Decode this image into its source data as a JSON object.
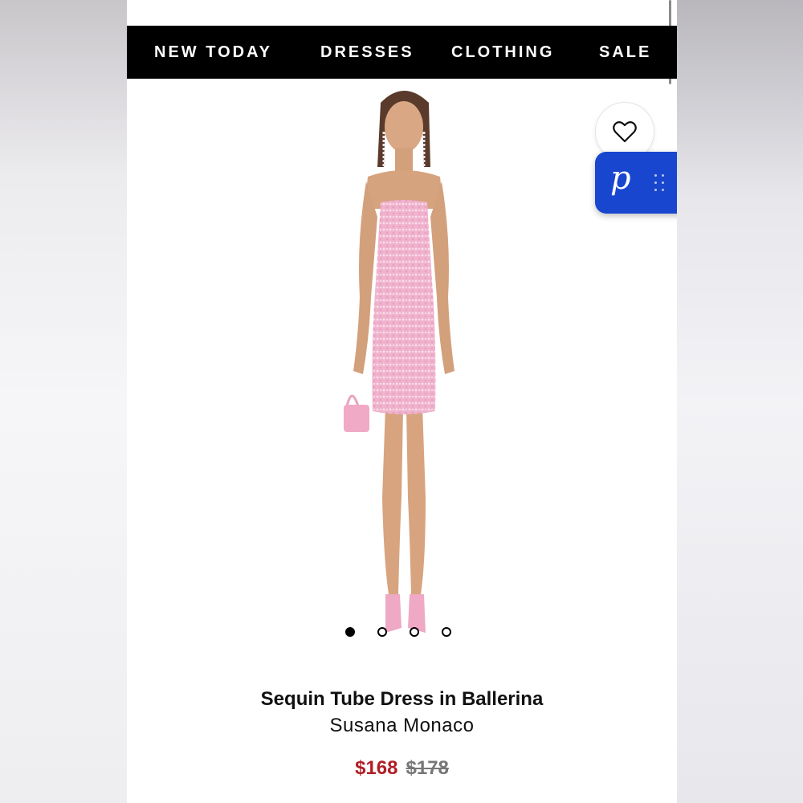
{
  "nav": {
    "items": [
      {
        "label": "NEW TODAY"
      },
      {
        "label": "DRESSES"
      },
      {
        "label": "CLOTHING"
      },
      {
        "label": "SALE"
      }
    ]
  },
  "product": {
    "title": "Sequin Tube Dress in Ballerina",
    "brand": "Susana Monaco",
    "price_sale": "$168",
    "price_original": "$178",
    "image_count": 4,
    "active_image": 1
  },
  "icons": {
    "wishlist": "heart-outline-icon",
    "poshmark": "poshmark-p-icon"
  },
  "colors": {
    "nav_bg": "#000000",
    "sale_price": "#b21e25",
    "original_price": "#777777",
    "poshmark_blue": "#1846cf",
    "dress_pink": "#f2b6cf"
  }
}
